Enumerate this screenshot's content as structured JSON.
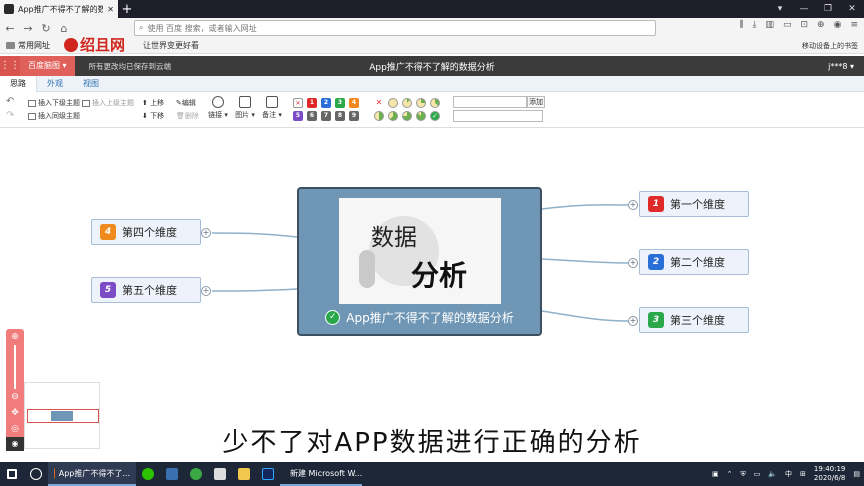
{
  "browser": {
    "tab_title": "App推广不得不了解的数据分析",
    "new_tab": "+",
    "address_placeholder": "使用 百度 搜索，或者输入网址",
    "bookmarks_label": "常用网址",
    "logo_text": "绍且网",
    "slogan": "让世界变更好看",
    "mobile_bookmarks": "移动设备上的书签"
  },
  "app": {
    "grid_icon": "⋮⋮",
    "name": "百度脑图 ▾",
    "saved_status": "所有更改均已保存到云端",
    "doc_title": "App推广不得不了解的数据分析",
    "user": "j***8 ▾"
  },
  "menu_tabs": [
    "思路",
    "外观",
    "视图"
  ],
  "toolbar": {
    "insert_child": "插入下级主题",
    "insert_parent": "插入上级主题",
    "insert_sibling": "插入同级主题",
    "move_up": "上移",
    "move_down": "下移",
    "edit": "编辑",
    "delete": "删除",
    "link": "链接 ▾",
    "image": "图片 ▾",
    "note": "备注 ▾",
    "add": "添加"
  },
  "mindmap": {
    "root_label": "App推广不得不了解的数据分析",
    "image_text_1": "数据",
    "image_text_2": "分析",
    "branches": [
      {
        "num": "1",
        "label": "第一个维度",
        "color": "#e02a2a"
      },
      {
        "num": "2",
        "label": "第二个维度",
        "color": "#2a6fd8"
      },
      {
        "num": "3",
        "label": "第三个维度",
        "color": "#2aa84a"
      },
      {
        "num": "4",
        "label": "第四个维度",
        "color": "#f08a1c"
      },
      {
        "num": "5",
        "label": "第五个维度",
        "color": "#7c4bc6"
      }
    ]
  },
  "subtitle": "少不了对APP数据进行正确的分析",
  "taskbar": {
    "browser_app": "App推广不得不了...",
    "word_app": "新建 Microsoft W...",
    "lang": "中",
    "time": "19:40:19",
    "date": "2020/6/8"
  }
}
